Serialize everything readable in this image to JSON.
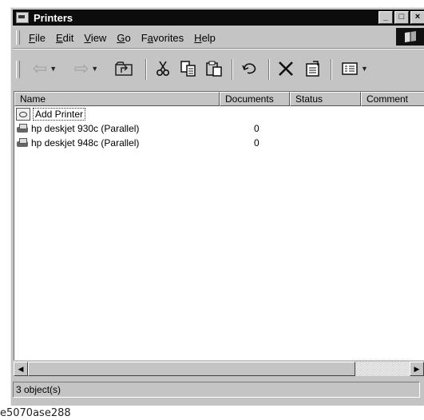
{
  "window": {
    "title": "Printers"
  },
  "menu": {
    "items": [
      {
        "label": "File",
        "accel": "F",
        "rest": "ile"
      },
      {
        "label": "Edit",
        "accel": "E",
        "rest": "dit"
      },
      {
        "label": "View",
        "accel": "V",
        "rest": "iew"
      },
      {
        "label": "Go",
        "accel": "G",
        "rest": "o"
      },
      {
        "label": "Favorites",
        "pre": "F",
        "accel": "a",
        "rest": "vorites"
      },
      {
        "label": "Help",
        "accel": "H",
        "rest": "elp"
      }
    ]
  },
  "toolbar": {
    "buttons": [
      "back-icon",
      "forward-icon",
      "up-folder-icon",
      "cut-icon",
      "copy-icon",
      "paste-icon",
      "undo-icon",
      "delete-icon",
      "properties-icon",
      "views-icon"
    ]
  },
  "list": {
    "columns": [
      "Name",
      "Documents",
      "Status",
      "Comment"
    ],
    "rows": [
      {
        "name": "Add Printer",
        "documents": ""
      },
      {
        "name": "hp deskjet 930c (Parallel)",
        "documents": "0"
      },
      {
        "name": "hp deskjet 948c (Parallel)",
        "documents": "0"
      }
    ]
  },
  "status": {
    "text": "3 object(s)"
  },
  "caption": "e5070ase288"
}
